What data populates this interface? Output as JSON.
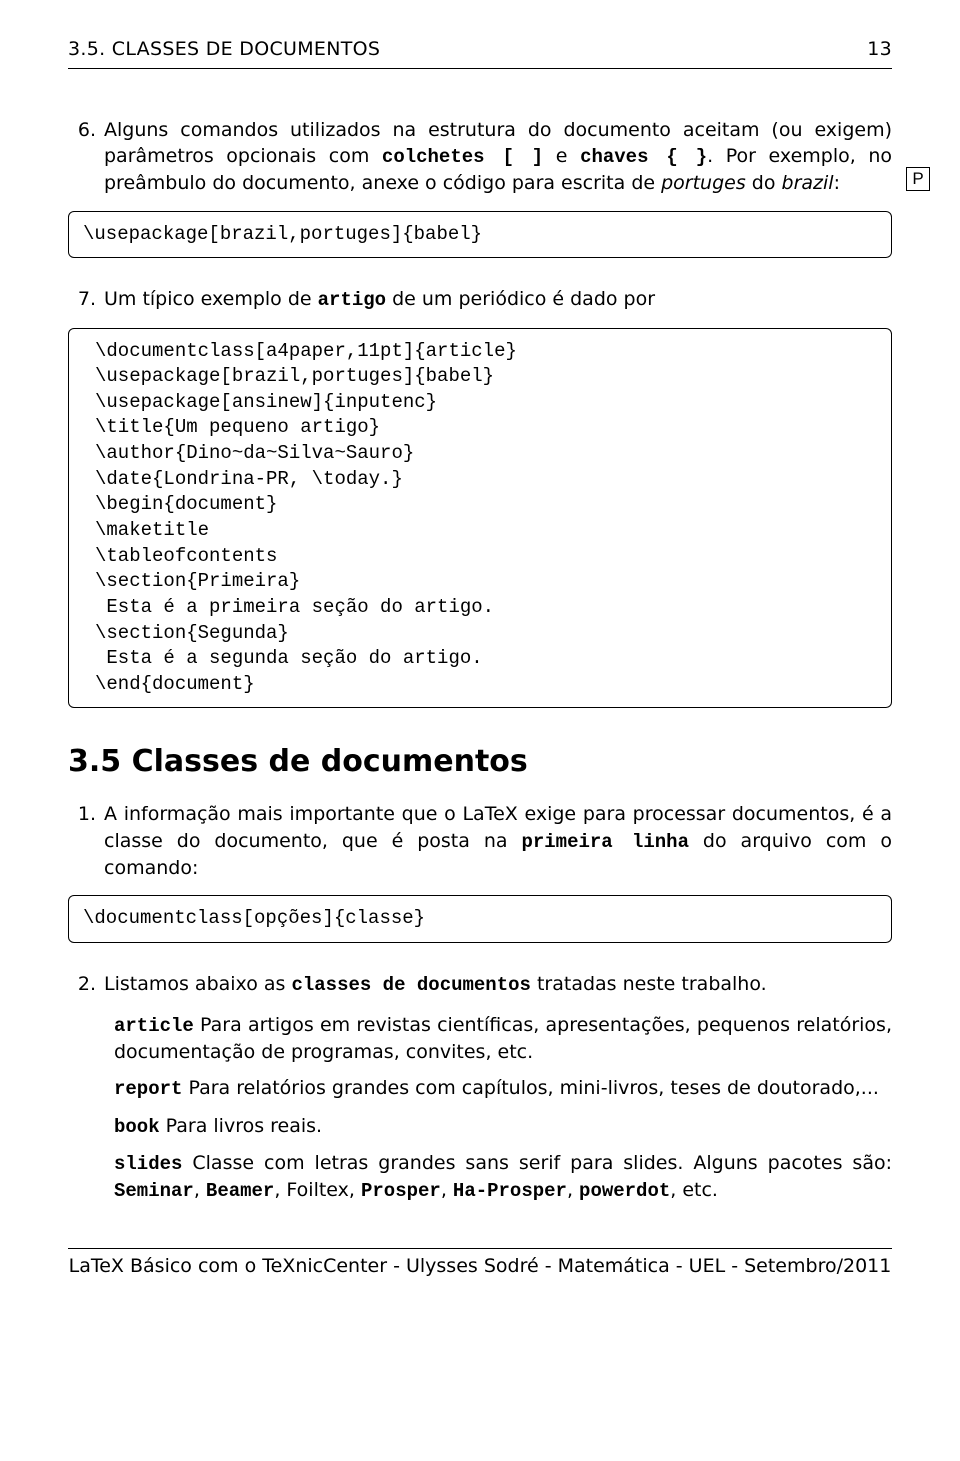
{
  "header": {
    "left": "3.5. CLASSES DE DOCUMENTOS",
    "right": "13"
  },
  "margin_p": "P",
  "item6": {
    "marker": "6.",
    "l1a": "Alguns comandos utilizados na estrutura do documento aceitam (ou exigem) parâmetros opcionais com ",
    "colchetes": "colchetes [ ]",
    "l1b": " e ",
    "chaves": "chaves { }",
    "l1c": ". Por exemplo, no preâmbulo do documento, anexe o código para escrita de ",
    "portuges": "portuges",
    "l1d": " do ",
    "brazil": "brazil",
    "l1e": ":"
  },
  "code1": "\\usepackage[brazil,portuges]{babel}",
  "item7": {
    "marker": "7.",
    "l1a": "Um típico exemplo de ",
    "artigo": "artigo",
    "l1b": " de um periódico é dado por"
  },
  "code2": "\\documentclass[a4paper,11pt]{article}\n\\usepackage[brazil,portuges]{babel}\n\\usepackage[ansinew]{inputenc}\n\\title{Um pequeno artigo}\n\\author{Dino~da~Silva~Sauro}\n\\date{Londrina-PR, \\today.}\n\\begin{document}\n\\maketitle\n\\tableofcontents\n\\section{Primeira}\n Esta é a primeira seção do artigo.\n\\section{Segunda}\n Esta é a segunda seção do artigo.\n\\end{document}",
  "section_heading": "3.5   Classes de documentos",
  "list1": {
    "marker": "1.",
    "a": "A informação mais importante que o LaTeX exige para processar documentos, é a classe do documento, que é posta na ",
    "primeira_linha": "primeira linha",
    "b": " do arquivo com o comando:"
  },
  "code3": "\\documentclass[opções]{classe}",
  "list2": {
    "marker": "2.",
    "a": "Listamos abaixo as ",
    "classes": "classes de documentos",
    "b": " tratadas neste trabalho."
  },
  "desc": {
    "article": {
      "term": "article",
      "body": " Para artigos em revistas científicas, apresentações, pequenos relatórios, documentação de programas, convites, etc."
    },
    "report": {
      "term": "report",
      "body": " Para relatórios grandes com capítulos, mini-livros, teses de doutorado,..."
    },
    "book": {
      "term": "book",
      "body": " Para livros reais."
    },
    "slides": {
      "term": "slides",
      "a": " Classe com letras grandes sans serif para slides. Alguns pacotes são: ",
      "seminar": "Seminar",
      "sep1": ", ",
      "beamer": "Beamer",
      "sep2": ", Foiltex, ",
      "prosper": "Prosper",
      "sep3": ", ",
      "haprosper": "Ha-Prosper",
      "sep4": ", ",
      "powerdot": "powerdot",
      "b": ", etc."
    }
  },
  "footer": "LaTeX Básico com o TeXnicCenter - Ulysses Sodré - Matemática - UEL - Setembro/2011"
}
